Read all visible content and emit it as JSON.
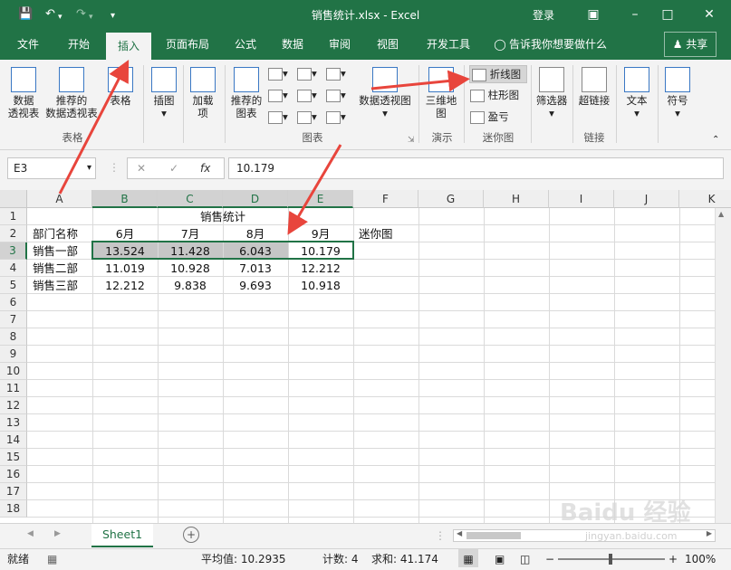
{
  "titlebar": {
    "title": "销售统计.xlsx - Excel",
    "login": "登录",
    "save_icon": "save-icon",
    "undo_icon": "undo-icon",
    "redo_icon": "redo-icon",
    "customize_icon": "customize-quick-access-icon",
    "ribbon_options_icon": "ribbon-display-options-icon",
    "minimize": "–",
    "maximize": "□",
    "close": "✕"
  },
  "tabs": {
    "file": "文件",
    "home": "开始",
    "insert": "插入",
    "page_layout": "页面布局",
    "formulas": "公式",
    "data": "数据",
    "review": "审阅",
    "view": "视图",
    "developer": "开发工具",
    "tell_me": "告诉我你想要做什么",
    "share": "共享"
  },
  "ribbon": {
    "tables": {
      "pivot": [
        "数据",
        "透视表"
      ],
      "recommended_pivot": [
        "推荐的",
        "数据透视表"
      ],
      "table": "表格",
      "group": "表格"
    },
    "illustrations": {
      "label": "插图"
    },
    "addins": {
      "label": [
        "加载",
        "项"
      ]
    },
    "charts": {
      "recommended": [
        "推荐的",
        "图表"
      ],
      "pivot_chart": "数据透视图",
      "group": "图表"
    },
    "tours": {
      "map3d": [
        "三维地",
        "图"
      ],
      "group": "演示"
    },
    "sparklines": {
      "line": "折线图",
      "column": "柱形图",
      "winloss": "盈亏",
      "group": "迷你图"
    },
    "filters": {
      "label": "筛选器"
    },
    "links": {
      "label": "超链接",
      "group": "链接"
    },
    "text": {
      "label": "文本"
    },
    "symbols": {
      "label": "符号"
    }
  },
  "formula_bar": {
    "name_box": "E3",
    "cancel": "✕",
    "enter": "✓",
    "fx": "fx",
    "value": "10.179"
  },
  "columns": [
    "A",
    "B",
    "C",
    "D",
    "E",
    "F",
    "G",
    "H",
    "I",
    "J",
    "K"
  ],
  "rows": [
    "1",
    "2",
    "3",
    "4",
    "5",
    "6",
    "7",
    "8",
    "9",
    "10",
    "11",
    "12",
    "13",
    "14",
    "15",
    "16",
    "17",
    "18"
  ],
  "cells": {
    "title": "销售统计",
    "header": [
      "部门名称",
      "6月",
      "7月",
      "8月",
      "9月",
      "迷你图"
    ],
    "data": [
      [
        "销售一部",
        "13.524",
        "11.428",
        "6.043",
        "10.179"
      ],
      [
        "销售二部",
        "11.019",
        "10.928",
        "7.013",
        "12.212"
      ],
      [
        "销售三部",
        "12.212",
        "9.838",
        "9.693",
        "10.918"
      ]
    ]
  },
  "sheet": {
    "tab": "Sheet1",
    "add": "+"
  },
  "status": {
    "ready": "就绪",
    "average": "平均值: 10.2935",
    "count": "计数: 4",
    "sum": "求和: 41.174",
    "zoom": "100%",
    "zoom_minus": "−",
    "zoom_plus": "+"
  },
  "watermark": "Baidu 经验 jingyan.baidu.com",
  "accent": "#217346",
  "annotation_color": "#e8453c"
}
